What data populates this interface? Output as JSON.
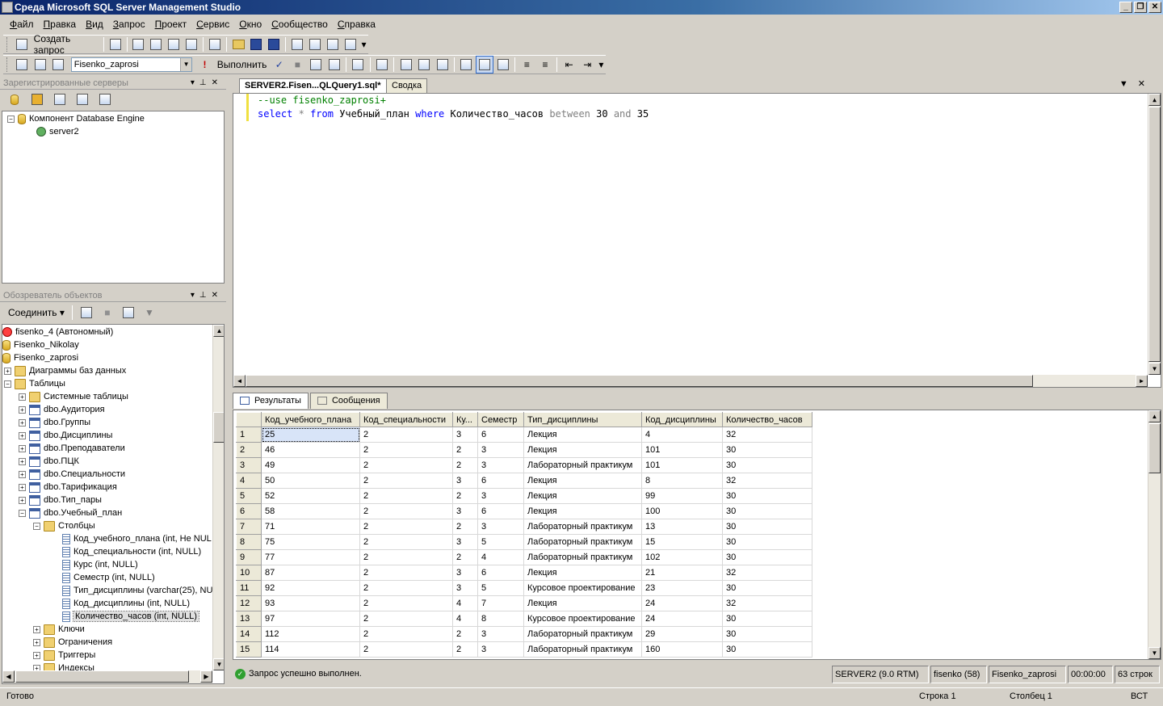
{
  "window": {
    "title": "Среда Microsoft SQL Server Management Studio"
  },
  "menu": [
    "Файл",
    "Правка",
    "Вид",
    "Запрос",
    "Проект",
    "Сервис",
    "Окно",
    "Сообщество",
    "Справка"
  ],
  "toolbar1": {
    "new_query": "Создать запрос"
  },
  "toolbar2": {
    "database": "Fisenko_zaprosi",
    "execute": "Выполнить"
  },
  "registered_servers": {
    "title": "Зарегистрированные серверы",
    "nodes": [
      {
        "label": "Компонент Database Engine"
      },
      {
        "label": "server2"
      }
    ]
  },
  "object_explorer": {
    "title": "Обозреватель объектов",
    "connect": "Соединить",
    "nodes": [
      {
        "label": "fisenko_4 (Автономный)"
      },
      {
        "label": "Fisenko_Nikolay"
      },
      {
        "label": "Fisenko_zaprosi"
      },
      {
        "label": "Диаграммы баз данных"
      },
      {
        "label": "Таблицы"
      },
      {
        "label": "Системные таблицы"
      },
      {
        "label": "dbo.Аудитория"
      },
      {
        "label": "dbo.Группы"
      },
      {
        "label": "dbo.Дисциплины"
      },
      {
        "label": "dbo.Преподаватели"
      },
      {
        "label": "dbo.ПЦК"
      },
      {
        "label": "dbo.Специальности"
      },
      {
        "label": "dbo.Тарификация"
      },
      {
        "label": "dbo.Тип_пары"
      },
      {
        "label": "dbo.Учебный_план"
      },
      {
        "label": "Столбцы"
      },
      {
        "label": "Код_учебного_плана (int, Не NUL"
      },
      {
        "label": "Код_специальности (int, NULL)"
      },
      {
        "label": "Курс (int, NULL)"
      },
      {
        "label": "Семестр (int, NULL)"
      },
      {
        "label": "Тип_дисциплины (varchar(25), NU"
      },
      {
        "label": "Код_дисциплины (int, NULL)"
      },
      {
        "label": "Количество_часов (int, NULL)"
      },
      {
        "label": "Ключи"
      },
      {
        "label": "Ограничения"
      },
      {
        "label": "Триггеры"
      },
      {
        "label": "Индексы"
      }
    ]
  },
  "tabs": {
    "query": "SERVER2.Fisen...QLQuery1.sql*",
    "summary": "Сводка"
  },
  "editor": {
    "line1": "--use fisenko_zaprosi+",
    "line2": {
      "select": "select",
      "star": "*",
      "from": "from",
      "table": "Учебный_план",
      "where": "where",
      "column": "Количество_часов",
      "between": "between",
      "v1": "30",
      "and": "and",
      "v2": "35"
    }
  },
  "result_tabs": {
    "results": "Результаты",
    "messages": "Сообщения"
  },
  "grid": {
    "columns": [
      "Код_учебного_плана",
      "Код_специальности",
      "Ку...",
      "Семестр",
      "Тип_дисциплины",
      "Код_дисциплины",
      "Количество_часов"
    ],
    "rows": [
      [
        "1",
        "25",
        "2",
        "3",
        "6",
        "Лекция",
        "4",
        "32"
      ],
      [
        "2",
        "46",
        "2",
        "2",
        "3",
        "Лекция",
        "101",
        "30"
      ],
      [
        "3",
        "49",
        "2",
        "2",
        "3",
        "Лабораторный практикум",
        "101",
        "30"
      ],
      [
        "4",
        "50",
        "2",
        "3",
        "6",
        "Лекция",
        "8",
        "32"
      ],
      [
        "5",
        "52",
        "2",
        "2",
        "3",
        "Лекция",
        "99",
        "30"
      ],
      [
        "6",
        "58",
        "2",
        "3",
        "6",
        "Лекция",
        "100",
        "30"
      ],
      [
        "7",
        "71",
        "2",
        "2",
        "3",
        "Лабораторный практикум",
        "13",
        "30"
      ],
      [
        "8",
        "75",
        "2",
        "3",
        "5",
        "Лабораторный практикум",
        "15",
        "30"
      ],
      [
        "9",
        "77",
        "2",
        "2",
        "4",
        "Лабораторный практикум",
        "102",
        "30"
      ],
      [
        "10",
        "87",
        "2",
        "3",
        "6",
        "Лекция",
        "21",
        "32"
      ],
      [
        "11",
        "92",
        "2",
        "3",
        "5",
        "Курсовое проектирование",
        "23",
        "30"
      ],
      [
        "12",
        "93",
        "2",
        "4",
        "7",
        "Лекция",
        "24",
        "32"
      ],
      [
        "13",
        "97",
        "2",
        "4",
        "8",
        "Курсовое проектирование",
        "24",
        "30"
      ],
      [
        "14",
        "112",
        "2",
        "2",
        "3",
        "Лабораторный практикум",
        "29",
        "30"
      ],
      [
        "15",
        "114",
        "2",
        "2",
        "3",
        "Лабораторный практикум",
        "160",
        "30"
      ]
    ]
  },
  "query_status": {
    "message": "Запрос успешно выполнен.",
    "server": "SERVER2 (9.0 RTM)",
    "user": "fisenko (58)",
    "database": "Fisenko_zaprosi",
    "time": "00:00:00",
    "rows": "63 строк"
  },
  "statusbar": {
    "ready": "Готово",
    "line": "Строка 1",
    "col": "Столбец 1",
    "mode": "ВСТ"
  }
}
